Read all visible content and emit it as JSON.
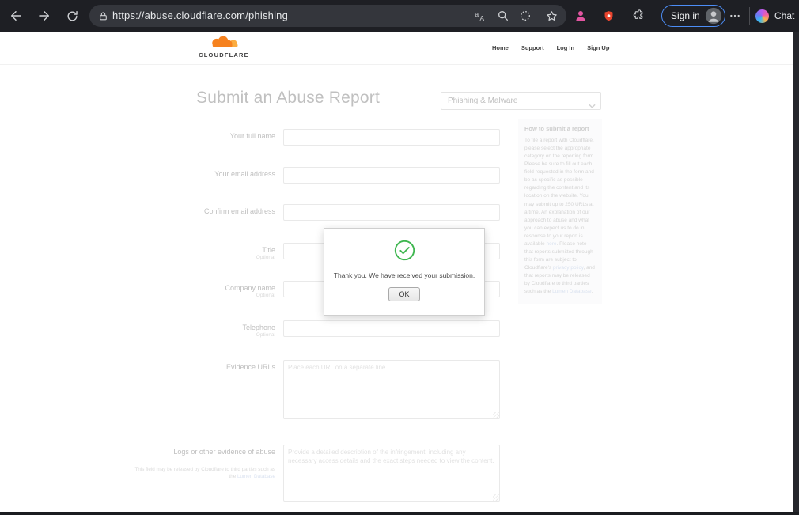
{
  "browser": {
    "url": "https://abuse.cloudflare.com/phishing",
    "sign_in_label": "Sign in",
    "chat_label": "Chat"
  },
  "site": {
    "logo_text": "CLOUDFLARE",
    "nav": {
      "home": "Home",
      "support": "Support",
      "log_in": "Log In",
      "sign_up": "Sign Up"
    }
  },
  "page": {
    "title": "Submit an Abuse Report",
    "category": "Phishing & Malware",
    "fields": [
      {
        "label": "Your full name",
        "optional": ""
      },
      {
        "label": "Your email address",
        "optional": ""
      },
      {
        "label": "Confirm email address",
        "optional": ""
      },
      {
        "label": "Title",
        "optional": "Optional"
      },
      {
        "label": "Company name",
        "optional": "Optional"
      },
      {
        "label": "Telephone",
        "optional": "Optional"
      }
    ],
    "evidence": {
      "label": "Evidence URLs",
      "placeholder": "Place each URL on a separate line"
    },
    "logs": {
      "label": "Logs or other evidence of abuse",
      "note": "This field may be released by Cloudflare to third parties such as the ",
      "note_link": "Lumen Database",
      "placeholder": "Provide a detailed description of the infringement, including any necessary access details and the exact steps needed to view the content."
    },
    "sidebar": {
      "title": "How to submit a report",
      "body_parts": [
        {
          "t": "To file a report with Cloudflare, please select the appropriate category on the reporting form. Please be sure to fill out each field requested in the form and be as specific as possible regarding the content and its location on the website. You may submit up to 250 URLs at a time. An explanation of our approach to abuse and what you can expect us to do in response to your report is available "
        },
        {
          "t": "here",
          "link": true
        },
        {
          "t": ". Please note that reports submitted through this form are subject to Cloudflare's "
        },
        {
          "t": "privacy policy",
          "link": true
        },
        {
          "t": ", and that reports may be released by Cloudflare to third parties such as the "
        },
        {
          "t": "Lumen Database",
          "link": true
        },
        {
          "t": "."
        }
      ]
    },
    "modal": {
      "message": "Thank you. We have received your submission.",
      "ok": "OK"
    }
  }
}
